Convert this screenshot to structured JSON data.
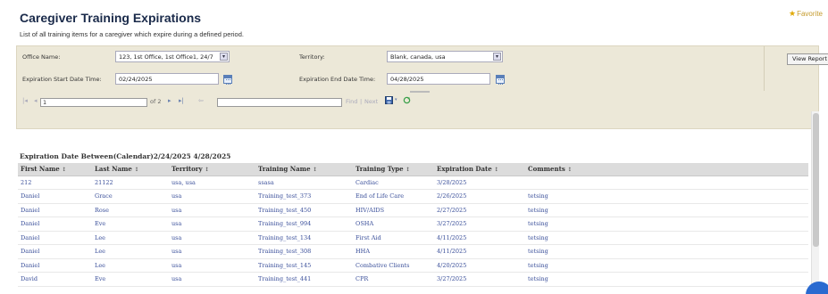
{
  "header": {
    "title": "Caregiver Training Expirations",
    "description": "List of all training items for a caregiver which expire during a defined period.",
    "favorite_label": "Favorite"
  },
  "filters": {
    "office_name_label": "Office Name:",
    "office_name_value": "123, 1st Office, 1st Office1, 24/7",
    "territory_label": "Territory:",
    "territory_value": "Blank, canada, usa",
    "start_date_label": "Expiration Start Date Time:",
    "start_date_value": "02/24/2025",
    "end_date_label": "Expiration End Date Time:",
    "end_date_value": "04/28/2025",
    "view_report_label": "View Report"
  },
  "toolbar": {
    "first_page": "|◂",
    "prev_page": "◂",
    "page_value": "1",
    "of_pages": "of 2",
    "next_page": "▸",
    "last_page": "▸|",
    "back": "⇦",
    "find_value": "",
    "find_label": "Find",
    "separator": "|",
    "next_label": "Next",
    "export_icon": "save-icon",
    "refresh_icon": "refresh-icon"
  },
  "report": {
    "title": "Expiration Date Between(Calendar)2/24/2025 4/28/2025",
    "columns": [
      "First Name",
      "Last Name",
      "Territory",
      "Training Name",
      "Training Type",
      "Expiration Date",
      "Comments"
    ],
    "sort_glyph": "↕",
    "rows": [
      [
        "212",
        "21122",
        "usa, usa",
        "ssasa",
        "Cardiac",
        "3/28/2025",
        ""
      ],
      [
        "Daniel",
        "Grace",
        "usa",
        "Training_test_373",
        "End of Life Care",
        "2/26/2025",
        "tetsing"
      ],
      [
        "Daniel",
        "Rose",
        "usa",
        "Training_test_450",
        "HIV/AIDS",
        "2/27/2025",
        "tetsing"
      ],
      [
        "Daniel",
        "Eve",
        "usa",
        "Training_test_994",
        "OSHA",
        "3/27/2025",
        "tetsing"
      ],
      [
        "Daniel",
        "Lee",
        "usa",
        "Training_test_134",
        "First Aid",
        "4/11/2025",
        "tetsing"
      ],
      [
        "Daniel",
        "Lee",
        "usa",
        "Training_test_308",
        "HHA",
        "4/11/2025",
        "tetsing"
      ],
      [
        "Daniel",
        "Lee",
        "usa",
        "Training_test_145",
        "Combative Clients",
        "4/20/2025",
        "tetsing"
      ],
      [
        "David",
        "Eve",
        "usa",
        "Training_test_441",
        "CPR",
        "3/27/2025",
        "tetsing"
      ]
    ]
  },
  "colors": {
    "panel_bg": "#ece8d8",
    "link": "#3a4f9a",
    "header_bg": "#dcdcdc",
    "favorite": "#c49a2c"
  }
}
